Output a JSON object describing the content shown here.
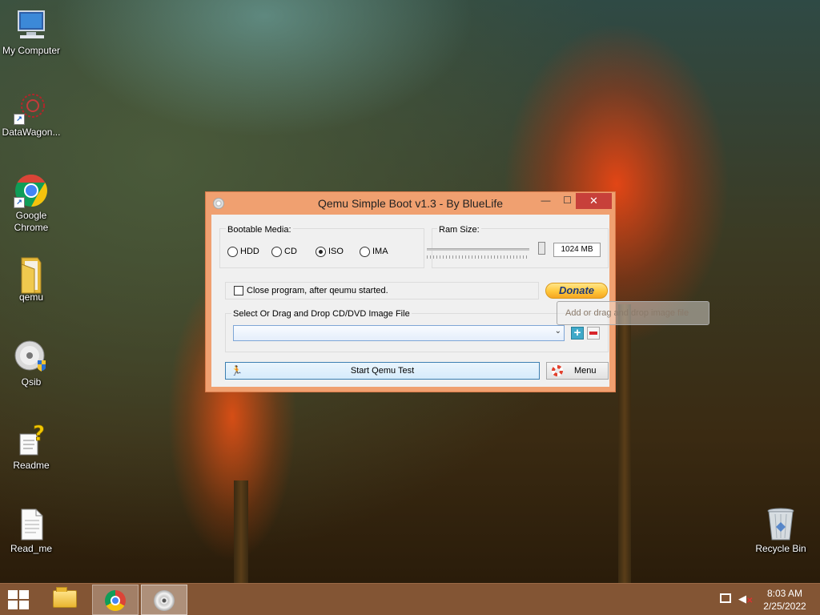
{
  "desktop": {
    "icons": [
      {
        "label": "My Computer"
      },
      {
        "label": "DataWagon..."
      },
      {
        "label": "Google Chrome"
      },
      {
        "label": "qemu"
      },
      {
        "label": "Qsib"
      },
      {
        "label": "Readme"
      },
      {
        "label": "Read_me"
      },
      {
        "label": "Recycle Bin"
      }
    ]
  },
  "window": {
    "title": "Qemu Simple Boot v1.3 - By BlueLife",
    "minimize_glyph": "—",
    "maximize_glyph": "☐",
    "close_glyph": "✕",
    "bootable_media": {
      "label": "Bootable Media:",
      "options": [
        "HDD",
        "CD",
        "ISO",
        "IMA"
      ],
      "selected": "ISO"
    },
    "ram": {
      "label": "Ram Size:",
      "value_text": "1024 MB",
      "slider_level": 1.0
    },
    "close_after_start": {
      "label": "Close program, after qeumu started.",
      "checked": false
    },
    "donate_label": "Donate",
    "image_file": {
      "label": "Select Or Drag and Drop CD/DVD Image File",
      "value": "",
      "dropdown_glyph": "⌄"
    },
    "add_glyph": "+",
    "start_label": "Start Qemu Test",
    "menu_label": "Menu"
  },
  "tooltip": {
    "text": "Add or drag and drop image file"
  },
  "taskbar": {
    "items": [
      "file-explorer",
      "google-chrome",
      "qemu-simple-boot"
    ],
    "active_item": "qemu-simple-boot",
    "clock": {
      "time": "8:03 AM",
      "date": "2/25/2022"
    }
  }
}
